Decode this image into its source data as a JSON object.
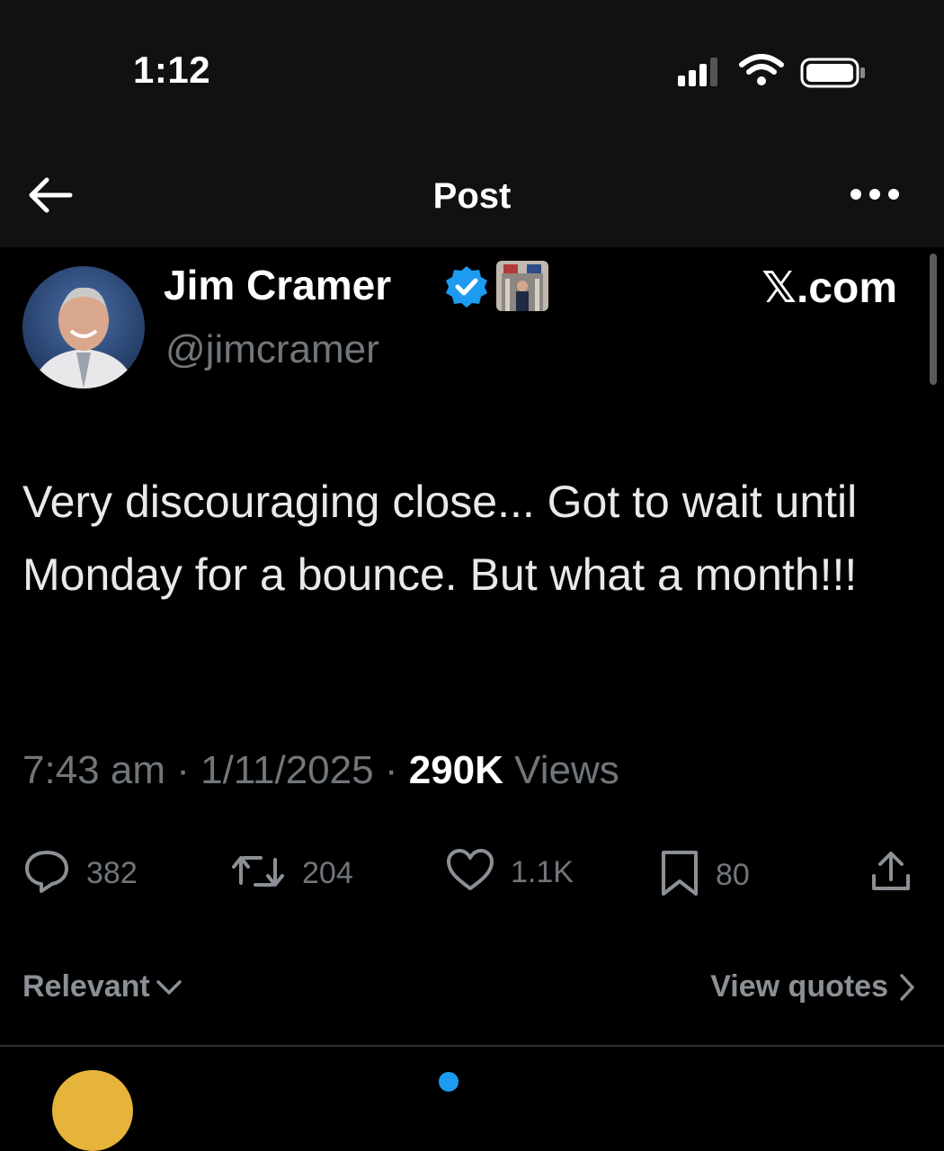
{
  "status_bar": {
    "time": "1:12"
  },
  "header": {
    "title": "Post"
  },
  "author": {
    "name": "Jim Cramer",
    "handle": "@jimcramer"
  },
  "watermark": "𝕏.com",
  "tweet": {
    "text": "Very discouraging close... Got to wait until Monday for a bounce. But what a month!!!",
    "time": "7:43 am",
    "date": "1/11/2025",
    "views_count": "290K",
    "views_label": "Views",
    "separator": "·"
  },
  "actions": {
    "replies": "382",
    "reposts": "204",
    "likes": "1.1K",
    "bookmarks": "80"
  },
  "footer": {
    "sort_label": "Relevant",
    "quotes_label": "View quotes"
  },
  "colors": {
    "background": "#000000",
    "text": "#e7e9ea",
    "muted": "#71767b",
    "accent": "#1d9bf0"
  },
  "icons": [
    "back-arrow-icon",
    "more-icon",
    "verified-icon",
    "reply-icon",
    "repost-icon",
    "like-icon",
    "bookmark-icon",
    "share-icon",
    "chevron-down-icon",
    "chevron-right-icon"
  ]
}
